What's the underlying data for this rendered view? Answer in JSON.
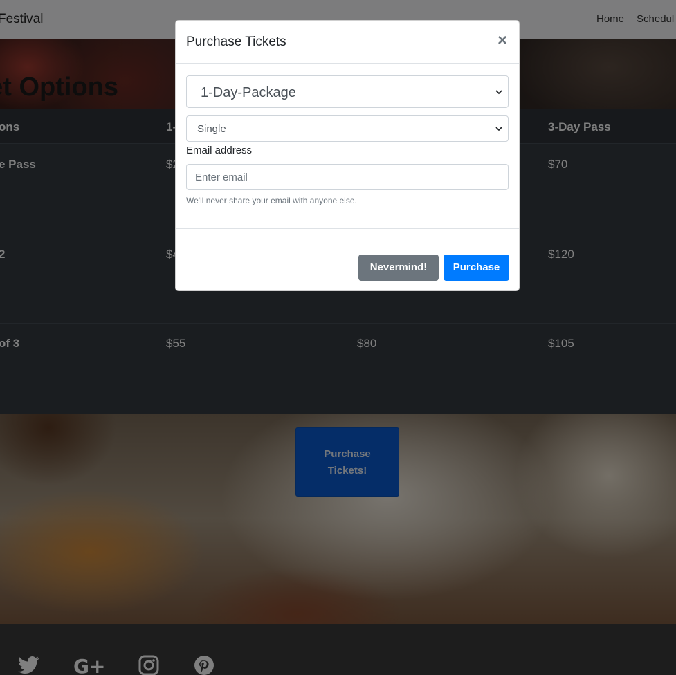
{
  "navbar": {
    "brand": "Festival",
    "links": [
      "Home",
      "Schedul"
    ]
  },
  "hero": {
    "title": "ket Options"
  },
  "ticket_table": {
    "headers": [
      "ons",
      "1-",
      "",
      "3-Day Pass"
    ],
    "rows": [
      {
        "label": "e Pass",
        "cells": [
          "$2",
          "",
          "$70"
        ]
      },
      {
        "label": "2",
        "cells": [
          "$4",
          "",
          "$120"
        ]
      },
      {
        "label": "of 3",
        "cells": [
          "$55",
          "$80",
          "$105"
        ]
      }
    ]
  },
  "cta": {
    "line1": "Purchase",
    "line2": "Tickets!"
  },
  "footer": {
    "social_icons": [
      "twitter-icon",
      "google-plus-icon",
      "instagram-icon",
      "pinterest-icon"
    ]
  },
  "modal": {
    "title": "Purchase Tickets",
    "close_symbol": "×",
    "package_select": {
      "value": "1-Day-Package"
    },
    "type_select": {
      "value": "Single"
    },
    "email": {
      "label": "Email address",
      "placeholder": "Enter email",
      "value": "",
      "help": "We'll never share your email with anyone else."
    },
    "buttons": {
      "cancel": "Nevermind!",
      "submit": "Purchase"
    }
  },
  "colors": {
    "primary": "#007bff",
    "secondary": "#6c757d",
    "table_dark": "#343a40",
    "backdrop": "rgba(0,0,0,0.5)"
  }
}
